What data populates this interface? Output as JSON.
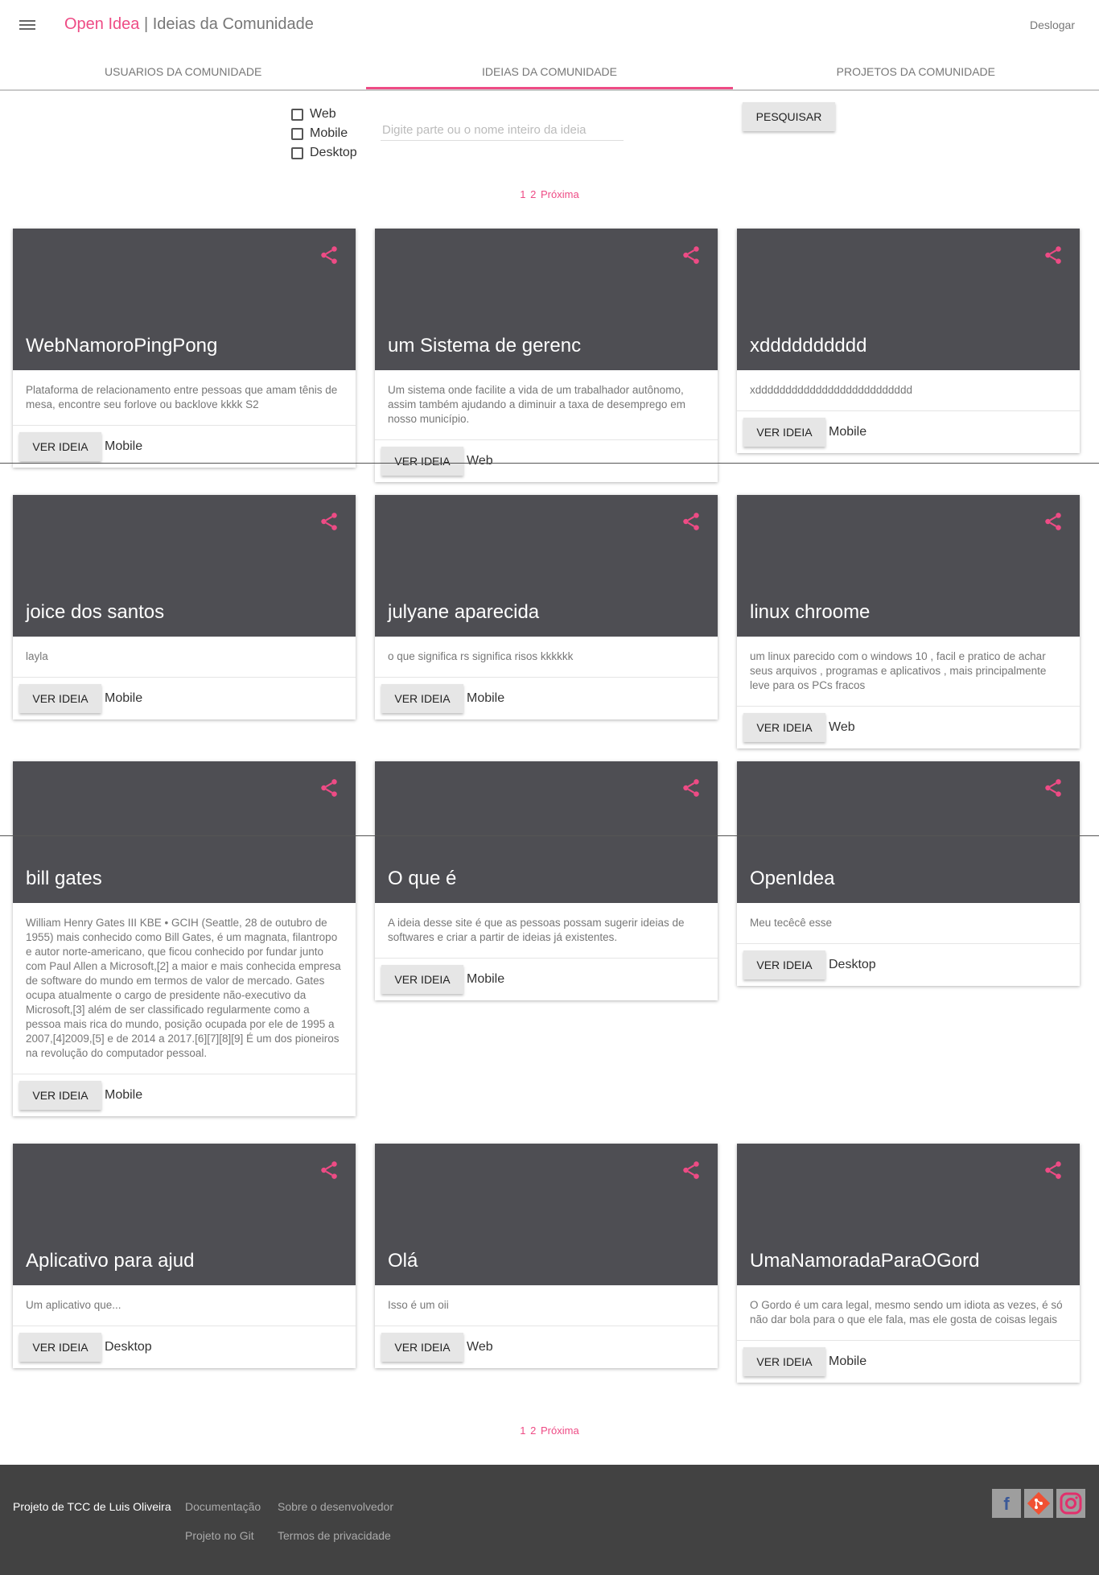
{
  "header": {
    "app_name": "Open Idea",
    "separator": " | ",
    "page_title": "Ideias da Comunidade",
    "logout_label": "Deslogar"
  },
  "tabs": [
    {
      "label": "USUARIOS DA COMUNIDADE",
      "active": false
    },
    {
      "label": "IDEIAS DA COMUNIDADE",
      "active": true
    },
    {
      "label": "PROJETOS DA COMUNIDADE",
      "active": false
    }
  ],
  "filters": {
    "options": [
      "Web",
      "Mobile",
      "Desktop"
    ],
    "search_placeholder": "Digite parte ou o nome inteiro da ideia",
    "search_button": "PESQUISAR"
  },
  "pagination": {
    "pages": [
      "1",
      "2"
    ],
    "next_label": "Próxima"
  },
  "cards": [
    {
      "title": "WebNamoroPingPong",
      "description": "Plataforma de relacionamento entre pessoas que amam tênis de mesa, encontre seu forlove ou backlove kkkk S2",
      "button": "VER IDEIA",
      "platform": "Mobile"
    },
    {
      "title": "um Sistema de gerenc",
      "description": "Um sistema onde facilite a vida de um trabalhador autônomo, assim também ajudando a diminuir a taxa de desemprego em nosso município.",
      "button": "VER IDEIA",
      "platform": "Web"
    },
    {
      "title": "xdddddddddd",
      "description": "xdddddddddddddddddddddddddd",
      "button": "VER IDEIA",
      "platform": "Mobile"
    },
    {
      "title": "joice dos santos",
      "description": "layla",
      "button": "VER IDEIA",
      "platform": "Mobile"
    },
    {
      "title": "julyane aparecida",
      "description": "o que significa rs significa risos kkkkkk",
      "button": "VER IDEIA",
      "platform": "Mobile"
    },
    {
      "title": "linux chroome",
      "description": "um linux parecido com o windows 10 , facil e pratico de achar seus arquivos , programas e aplicativos , mais principalmente leve para os PCs fracos",
      "button": "VER IDEIA",
      "platform": "Web"
    },
    {
      "title": "bill gates",
      "description": "William Henry Gates III KBE • GCIH (Seattle, 28 de outubro de 1955) mais conhecido como Bill Gates, é um magnata, filantropo e autor norte-americano, que ficou conhecido por fundar junto com Paul Allen a Microsoft,[2] a maior e mais conhecida empresa de software do mundo em termos de valor de mercado. Gates ocupa atualmente o cargo de presidente não-executivo da Microsoft,[3] além de ser classificado regularmente como a pessoa mais rica do mundo, posição ocupada por ele de 1995 a 2007,[4]2009,[5] e de 2014 a 2017.[6][7][8][9] É um dos pioneiros na revolução do computador pessoal.",
      "button": "VER IDEIA",
      "platform": "Mobile"
    },
    {
      "title": "O que é",
      "description": "A ideia desse site é que as pessoas possam sugerir ideias de softwares e criar a partir de ideias já existentes.",
      "button": "VER IDEIA",
      "platform": "Mobile"
    },
    {
      "title": "OpenIdea",
      "description": "Meu tecêcê esse",
      "button": "VER IDEIA",
      "platform": "Desktop"
    },
    {
      "title": "Aplicativo para ajud",
      "description": "Um aplicativo que...",
      "button": "VER IDEIA",
      "platform": "Desktop"
    },
    {
      "title": "Olá",
      "description": "Isso é um oii",
      "button": "VER IDEIA",
      "platform": "Web"
    },
    {
      "title": "UmaNamoradaParaOGord",
      "description": "O Gordo é um cara legal, mesmo sendo um idiota as vezes, é só não dar bola para o que ele fala, mas ele gosta de coisas legais",
      "button": "VER IDEIA",
      "platform": "Mobile"
    }
  ],
  "footer": {
    "credit": "Projeto de TCC de Luis Oliveira",
    "links": [
      "Documentação",
      "Sobre o desenvolvedor",
      "Projeto no Git",
      "Termos de privacidade"
    ],
    "social_icons": [
      "facebook-icon",
      "git-icon",
      "instagram-icon"
    ]
  },
  "colors": {
    "accent": "#ee4b85",
    "card_header": "#4e4e53",
    "footer_bg": "#424242"
  }
}
